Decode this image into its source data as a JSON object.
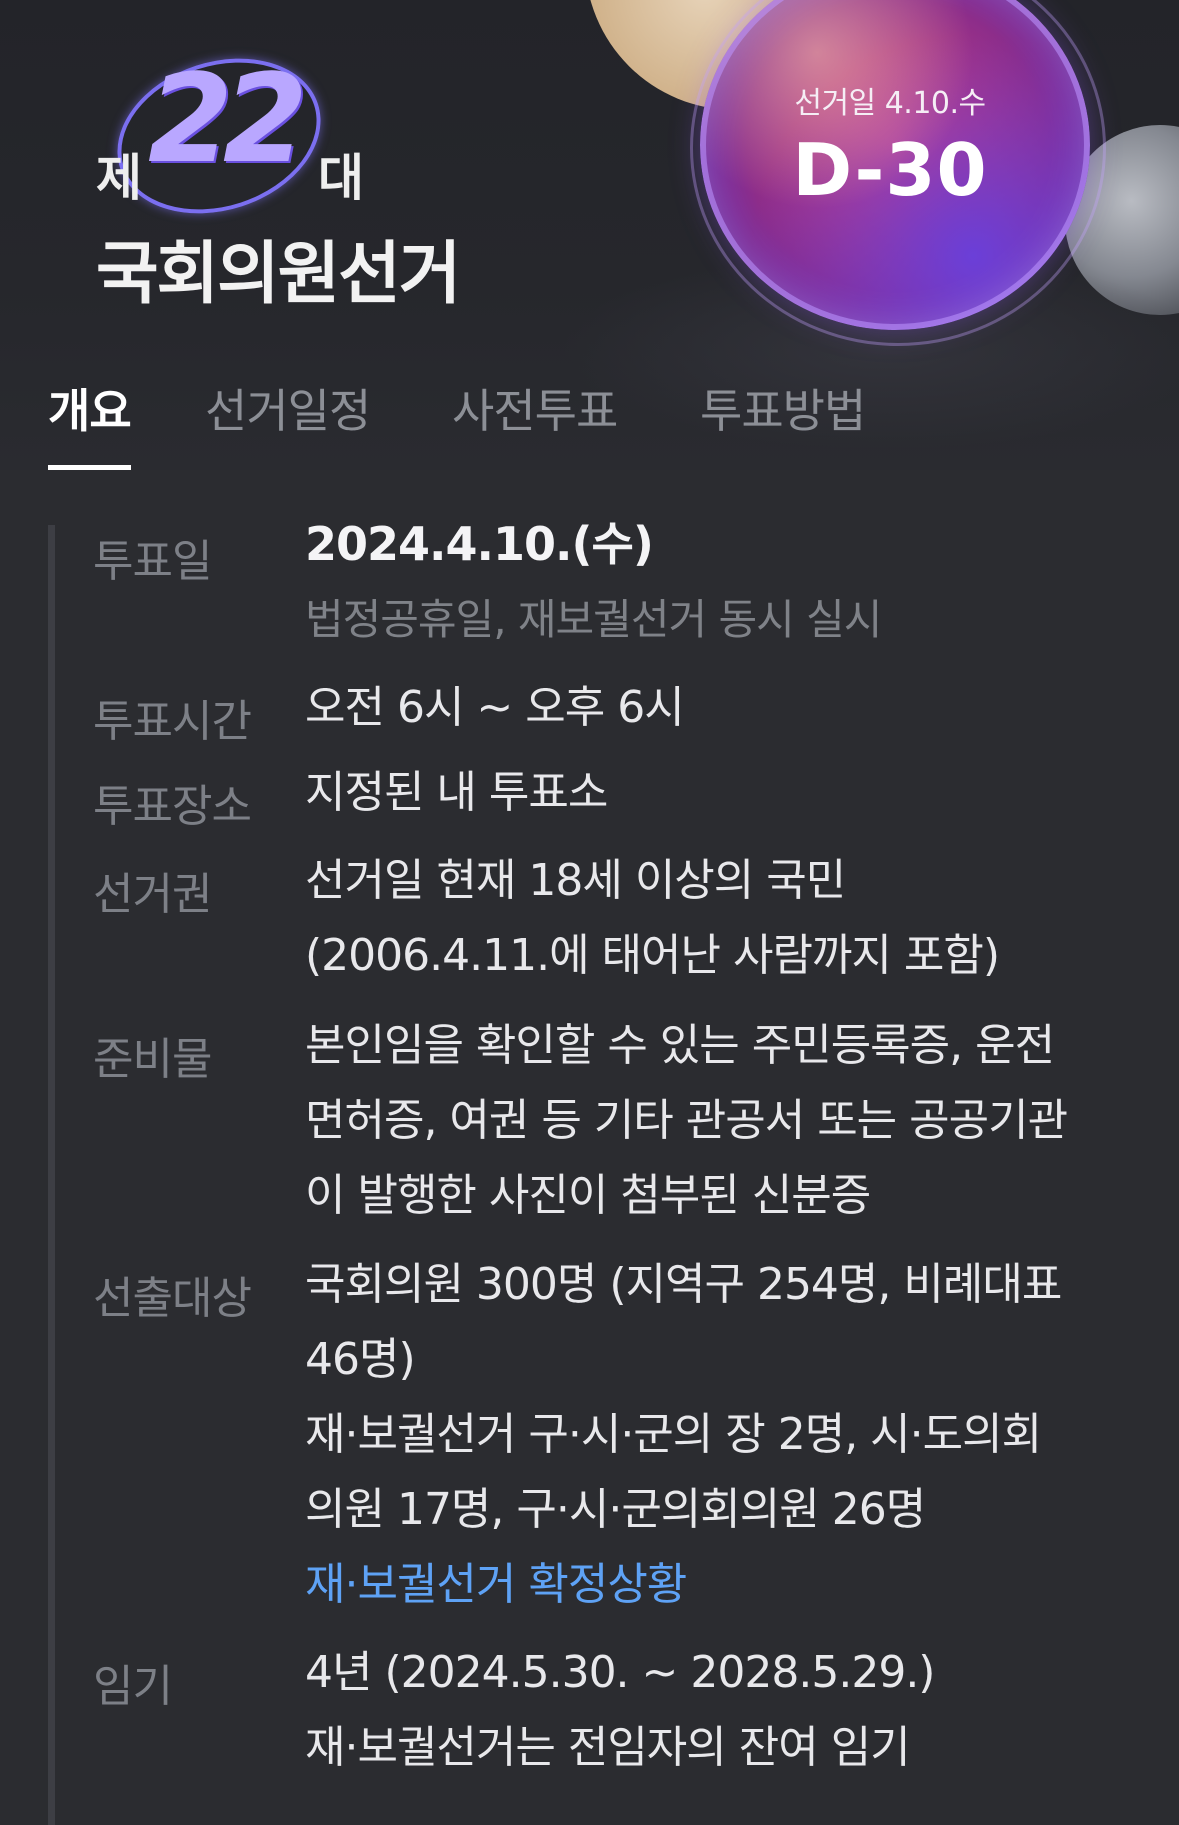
{
  "hero": {
    "logo_prefix": "제",
    "logo_number": "22",
    "logo_suffix": "대",
    "title": "국회의원선거",
    "dday_caption": "선거일 4.10.수",
    "dday_value": "D-30"
  },
  "tabs": [
    {
      "label": "개요",
      "active": true
    },
    {
      "label": "선거일정",
      "active": false
    },
    {
      "label": "사전투표",
      "active": false
    },
    {
      "label": "투표방법",
      "active": false
    }
  ],
  "overview": {
    "vote_date": {
      "label": "투표일",
      "value": "2024.4.10.(수)",
      "note": "법정공휴일, 재보궐선거 동시 실시"
    },
    "vote_time": {
      "label": "투표시간",
      "value": "오전 6시 ~ 오후 6시"
    },
    "vote_place": {
      "label": "투표장소",
      "value": "지정된 내 투표소"
    },
    "suffrage": {
      "label": "선거권",
      "line1": "선거일 현재 18세 이상의 국민",
      "line2": "(2006.4.11.에 태어난 사람까지 포함)"
    },
    "items": {
      "label": "준비물",
      "line1": "본인임을 확인할 수 있는 주민등록증, 운전",
      "line2": "면허증, 여권 등 기타 관공서 또는 공공기관",
      "line3": "이 발행한 사진이 첨부된 신분증"
    },
    "target": {
      "label": "선출대상",
      "line1": "국회의원 300명 (지역구 254명, 비례대표",
      "line2": "46명)",
      "line3": "재·보궐선거 구·시·군의 장 2명, 시·도의회",
      "line4": "의원 17명, 구·시·군의회의원 26명",
      "link": "재·보궐선거 확정상황"
    },
    "term": {
      "label": "임기",
      "line1": "4년 (2024.5.30. ~ 2028.5.29.)",
      "line2": "재·보궐선거는 전임자의 잔여 임기"
    }
  },
  "colors": {
    "background": "#2b2c30",
    "link": "#5ea2f5",
    "label": "#7d8087"
  }
}
